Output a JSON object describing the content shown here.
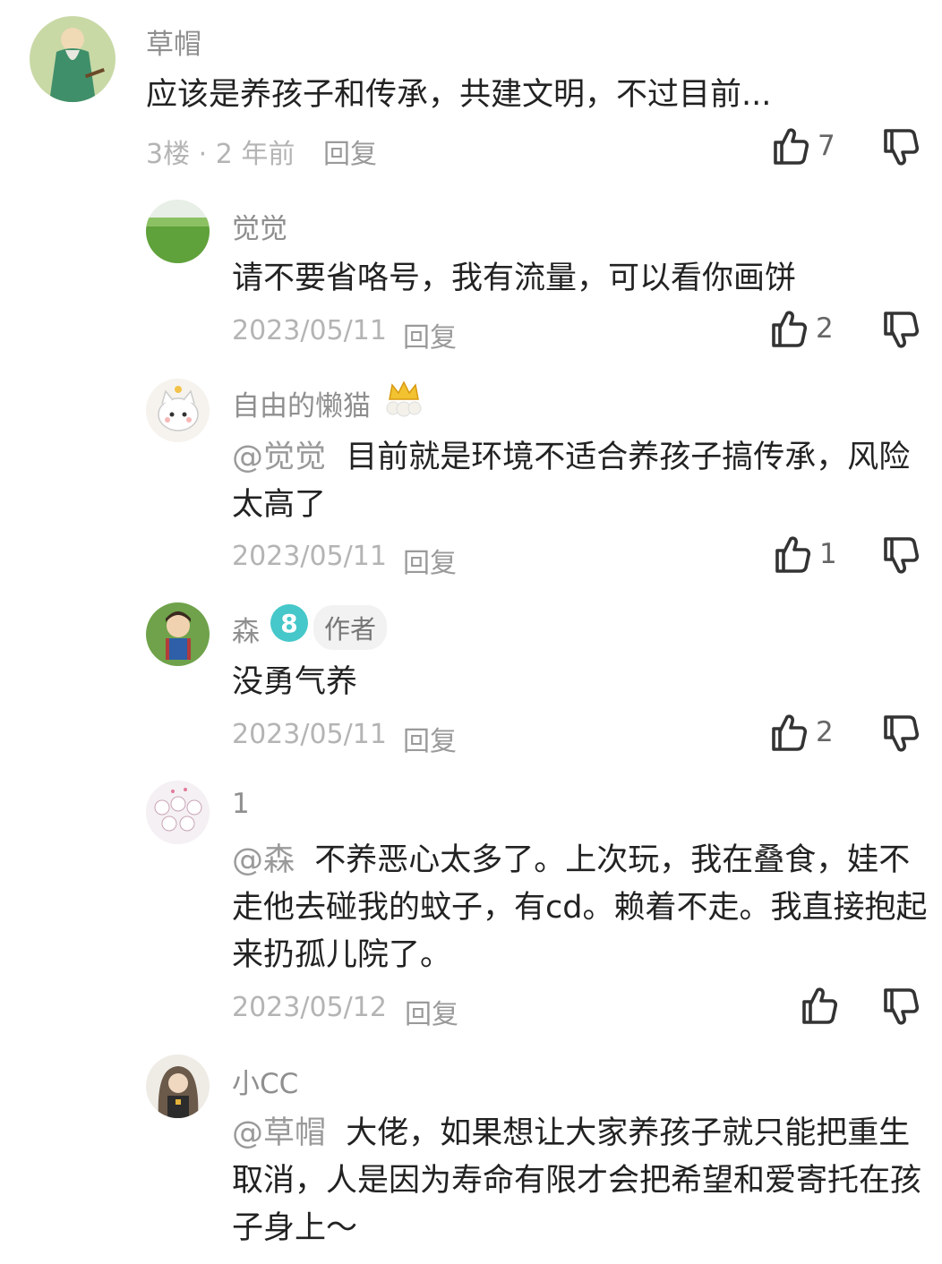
{
  "comments": [
    {
      "username": "草帽",
      "text": "应该是养孩子和传承，共建文明，不过目前...",
      "floor": "3楼 · 2 年前",
      "reply_label": "回复",
      "likes": "7"
    },
    {
      "username": "觉觉",
      "text": "请不要省咯号，我有流量，可以看你画饼",
      "date": "2023/05/11",
      "reply_label": "回复",
      "likes": "2"
    },
    {
      "username": "自由的懒猫",
      "mention": "@觉觉",
      "text": "目前就是环境不适合养孩子搞传承，风险太高了",
      "date": "2023/05/11",
      "reply_label": "回复",
      "likes": "1"
    },
    {
      "username": "森",
      "level": "8",
      "badge": "作者",
      "text": "没勇气养",
      "date": "2023/05/11",
      "reply_label": "回复",
      "likes": "2"
    },
    {
      "username": "1",
      "mention": "@森",
      "text": "不养恶心太多了。上次玩，我在叠食，娃不走他去碰我的蚊子，有cd。赖着不走。我直接抱起来扔孤儿院了。",
      "date": "2023/05/12",
      "reply_label": "回复",
      "likes": ""
    },
    {
      "username": "小CC",
      "mention": "@草帽",
      "text": "大佬，如果想让大家养孩子就只能把重生取消，人是因为寿命有限才会把希望和爱寄托在孩子身上～"
    }
  ],
  "icons": {
    "like": "thumbs-up-icon",
    "dislike": "thumbs-down-icon",
    "crown": "crown-icon",
    "level": "level-badge-icon"
  },
  "colors": {
    "username": "#8f8f8f",
    "meta": "#b4b4b4",
    "text": "#222222",
    "level_badge": "#46c7c9"
  }
}
